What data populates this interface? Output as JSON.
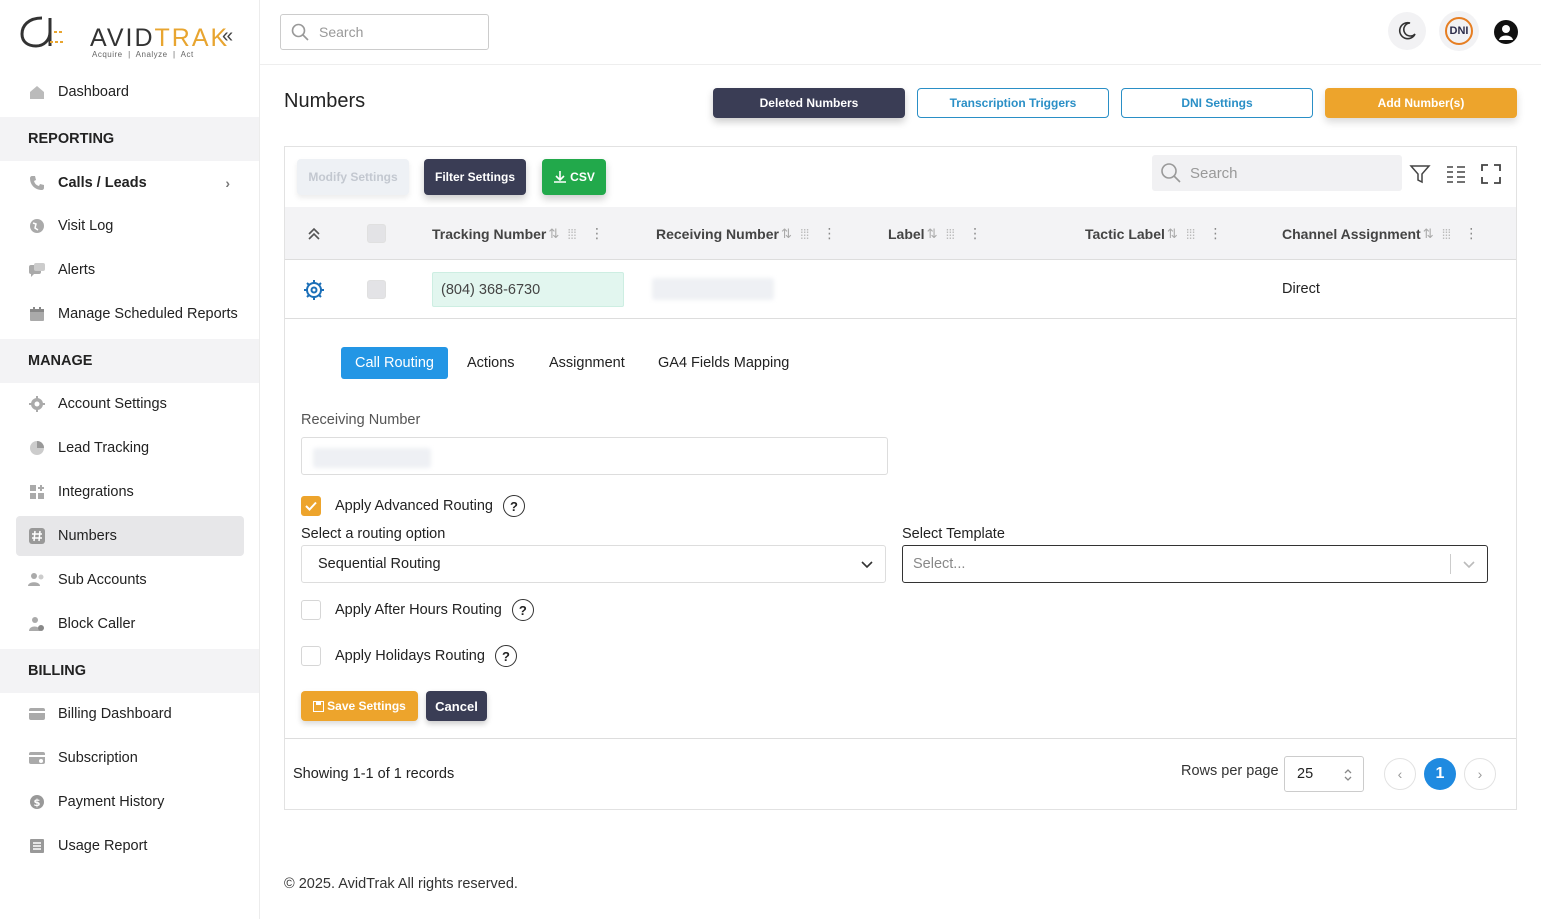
{
  "brand": {
    "name_part1": "AVID",
    "name_part2": "TRAK",
    "tagline": "Acquire  |  Analyze  |  Act"
  },
  "sidebar": {
    "dashboard": "Dashboard",
    "reporting_header": "REPORTING",
    "calls_leads": "Calls / Leads",
    "visit_log": "Visit Log",
    "alerts": "Alerts",
    "scheduled_reports": "Manage Scheduled Reports",
    "manage_header": "MANAGE",
    "account_settings": "Account Settings",
    "lead_tracking": "Lead Tracking",
    "integrations": "Integrations",
    "numbers": "Numbers",
    "sub_accounts": "Sub Accounts",
    "block_caller": "Block Caller",
    "billing_header": "BILLING",
    "billing_dashboard": "Billing Dashboard",
    "subscription": "Subscription",
    "payment_history": "Payment History",
    "usage_report": "Usage Report"
  },
  "topbar": {
    "search_placeholder": "Search",
    "dni_badge": "DNI"
  },
  "page": {
    "title": "Numbers",
    "deleted_numbers": "Deleted Numbers",
    "transcription_triggers": "Transcription Triggers",
    "dni_settings": "DNI Settings",
    "add_numbers": "Add Number(s)"
  },
  "toolbar": {
    "modify_settings": "Modify Settings",
    "filter_settings": "Filter Settings",
    "csv": "CSV",
    "search_placeholder": "Search"
  },
  "table": {
    "columns": [
      "Tracking Number",
      "Receiving Number",
      "Label",
      "Tactic Label",
      "Channel Assignment"
    ],
    "row": {
      "tracking_number": "(804) 368-6730",
      "channel_assignment": "Direct"
    }
  },
  "detail": {
    "tabs": [
      "Call Routing",
      "Actions",
      "Assignment",
      "GA4 Fields Mapping"
    ],
    "receiving_number_label": "Receiving Number",
    "apply_advanced_routing": "Apply Advanced Routing",
    "routing_option_label": "Select a routing option",
    "routing_option_value": "Sequential Routing",
    "template_label": "Select Template",
    "template_placeholder": "Select...",
    "after_hours": "Apply After Hours Routing",
    "holidays": "Apply Holidays Routing",
    "save": "Save Settings",
    "cancel": "Cancel"
  },
  "pagination": {
    "showing": "Showing 1-1 of 1 records",
    "rows_per_page_label": "Rows per page",
    "rows_per_page": "25",
    "current_page": "1"
  },
  "footer": {
    "copyright": "© 2025. AvidTrak All rights reserved."
  },
  "colors": {
    "accent_orange": "#eda42c",
    "dark_navy": "#3a3d55",
    "primary_blue": "#2396e5",
    "csv_green": "#22a94b"
  }
}
